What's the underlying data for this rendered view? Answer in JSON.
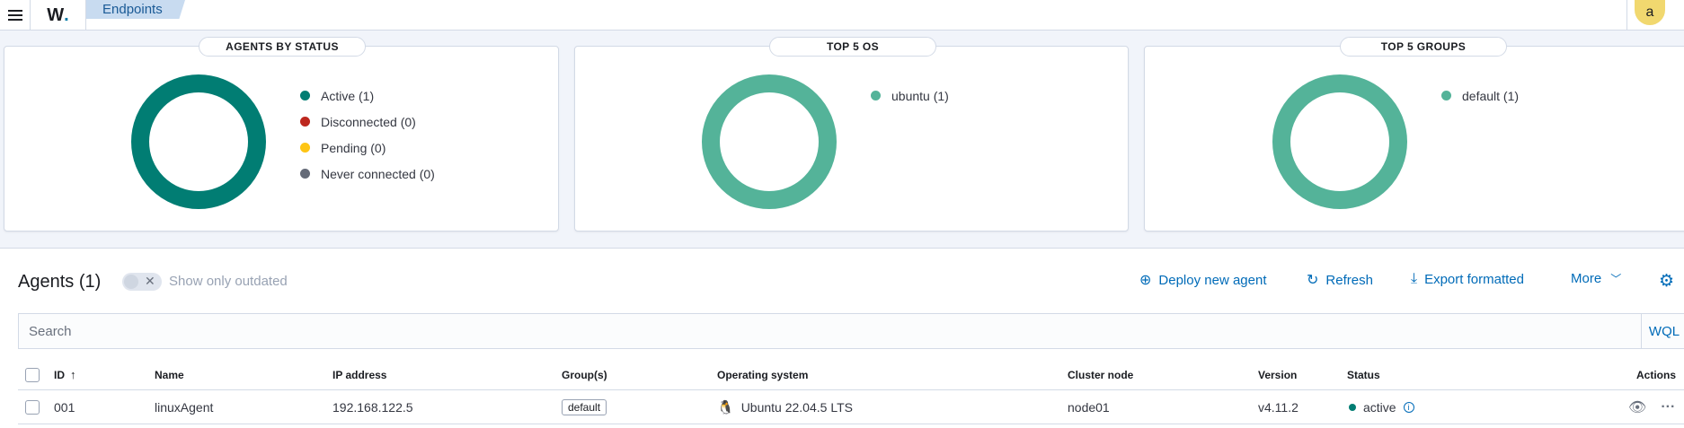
{
  "header": {
    "logo_text": "W",
    "logo_dot": ".",
    "breadcrumb": "Endpoints",
    "avatar_initial": "a"
  },
  "panels": [
    {
      "title": "AGENTS BY STATUS",
      "chart_color": "#017d73",
      "legend": [
        {
          "label": "Active (1)",
          "color": "#017d73"
        },
        {
          "label": "Disconnected (0)",
          "color": "#bd271e"
        },
        {
          "label": "Pending (0)",
          "color": "#fec514"
        },
        {
          "label": "Never connected (0)",
          "color": "#646a77"
        }
      ]
    },
    {
      "title": "TOP 5 OS",
      "chart_color": "#54b399",
      "legend": [
        {
          "label": "ubuntu (1)",
          "color": "#54b399"
        }
      ]
    },
    {
      "title": "TOP 5 GROUPS",
      "chart_color": "#54b399",
      "legend": [
        {
          "label": "default (1)",
          "color": "#54b399"
        }
      ]
    }
  ],
  "agents": {
    "title": "Agents (1)",
    "toggle_label": "Show only outdated",
    "actions": {
      "deploy": "Deploy new agent",
      "refresh": "Refresh",
      "export": "Export formatted",
      "more": "More"
    },
    "search_placeholder": "Search",
    "wql": "WQL",
    "columns": {
      "id": "ID",
      "name": "Name",
      "ip": "IP address",
      "groups": "Group(s)",
      "os": "Operating system",
      "cluster": "Cluster node",
      "version": "Version",
      "status": "Status",
      "actions": "Actions"
    },
    "rows": [
      {
        "id": "001",
        "name": "linuxAgent",
        "ip": "192.168.122.5",
        "group": "default",
        "os": "Ubuntu 22.04.5 LTS",
        "cluster": "node01",
        "version": "v4.11.2",
        "status": "active",
        "status_color": "#017d73"
      }
    ]
  }
}
